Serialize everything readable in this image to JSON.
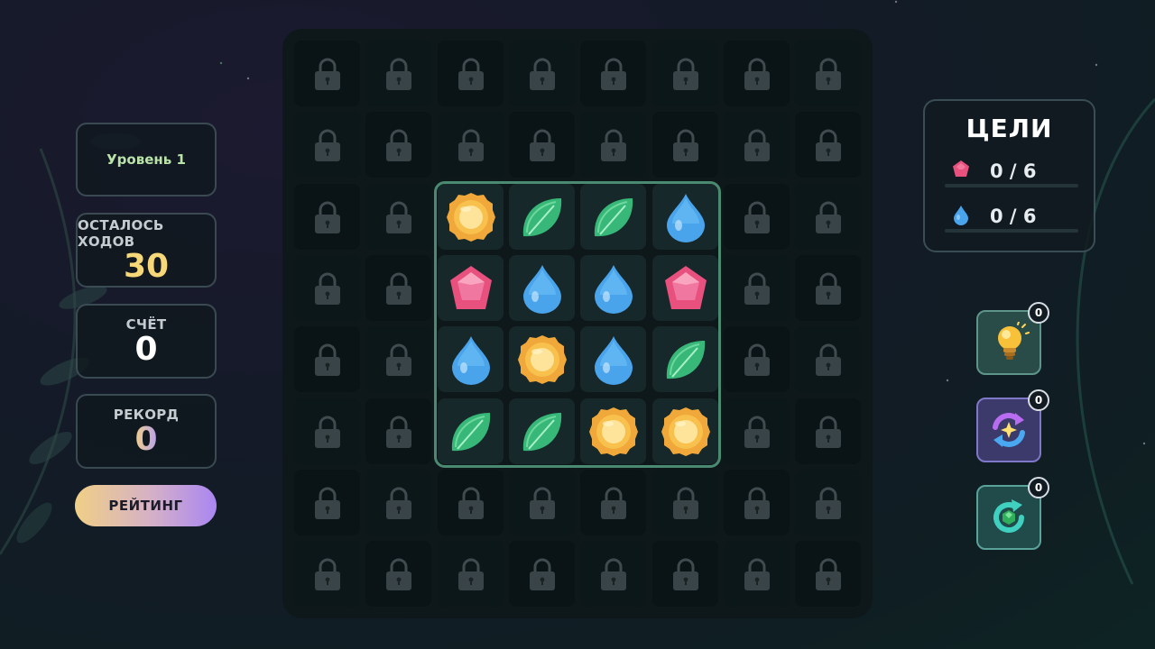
{
  "colors": {
    "accent_moves": "#f6d878",
    "frame": "#4a8a70",
    "gem_red": "#e8507e",
    "gem_blue": "#4aa4ec"
  },
  "stats": {
    "level_label": "Уровень 1",
    "moves_label": "ОСТАЛОСЬ ХОДОВ",
    "moves_value": "30",
    "score_label": "СЧЁТ",
    "score_value": "0",
    "record_label": "РЕКОРД",
    "record_value": "0"
  },
  "rating_button": "РЕЙТИНГ",
  "board": {
    "rows": 8,
    "cols": 8,
    "locked_icon": "padlock-icon",
    "active_area": {
      "row_start": 2,
      "col_start": 2,
      "rows": 4,
      "cols": 4
    },
    "pieces": [
      [
        "coin",
        "leaf",
        "leaf",
        "drop"
      ],
      [
        "ruby",
        "drop",
        "drop",
        "ruby"
      ],
      [
        "drop",
        "coin",
        "drop",
        "leaf"
      ],
      [
        "leaf",
        "leaf",
        "coin",
        "coin"
      ]
    ]
  },
  "goals": {
    "title": "ЦЕЛИ",
    "items": [
      {
        "icon": "ruby-gem-icon",
        "text": "0 / 6"
      },
      {
        "icon": "water-drop-icon",
        "text": "0 / 6"
      }
    ]
  },
  "boosters": [
    {
      "name": "hint",
      "icon": "lightbulb-icon",
      "count": "0"
    },
    {
      "name": "shuffle",
      "icon": "shuffle-icon",
      "count": "0"
    },
    {
      "name": "refresh",
      "icon": "refresh-icon",
      "count": "0"
    }
  ]
}
